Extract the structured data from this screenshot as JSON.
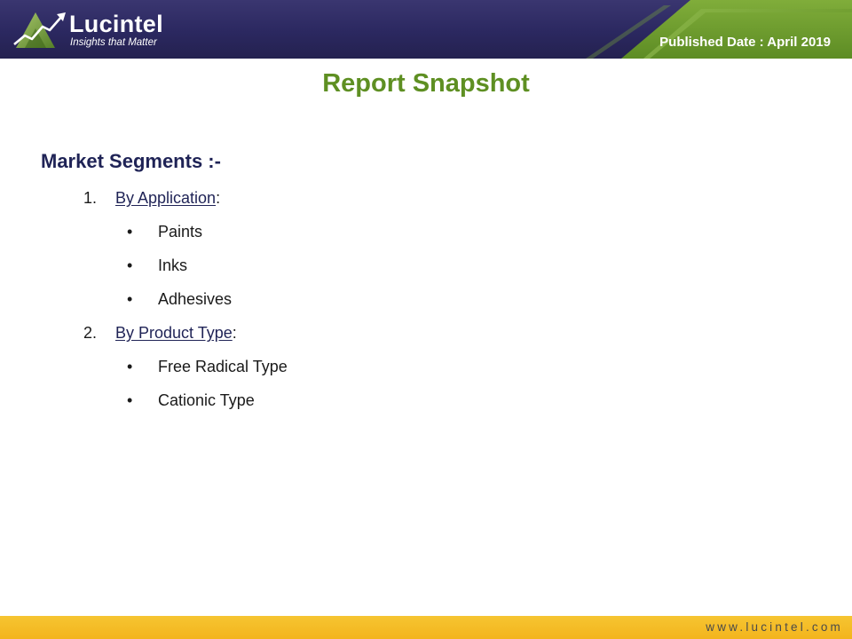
{
  "header": {
    "logo": {
      "name": "Lucintel",
      "tagline": "Insights that Matter"
    },
    "published_date": "Published Date : April 2019"
  },
  "title": "Report Snapshot",
  "market_segments": {
    "heading": "Market Segments :-",
    "groups": [
      {
        "number": "1.",
        "label": "By Application",
        "suffix": ":",
        "items": [
          "Paints",
          "Inks",
          "Adhesives"
        ]
      },
      {
        "number": "2.",
        "label": "By Product Type",
        "suffix": ":",
        "items": [
          "Free Radical Type",
          "Cationic Type"
        ]
      }
    ],
    "bullet_glyph": "•"
  },
  "footer": {
    "url": "www.lucintel.com"
  },
  "colors": {
    "header_navy": "#2b2860",
    "header_green": "#6a9a2a",
    "title_green": "#5e8f22",
    "heading_navy": "#1f2356",
    "footer_gold": "#f3b41d"
  },
  "icons": {
    "logo_mark": "rising-chart-arrow-icon"
  }
}
